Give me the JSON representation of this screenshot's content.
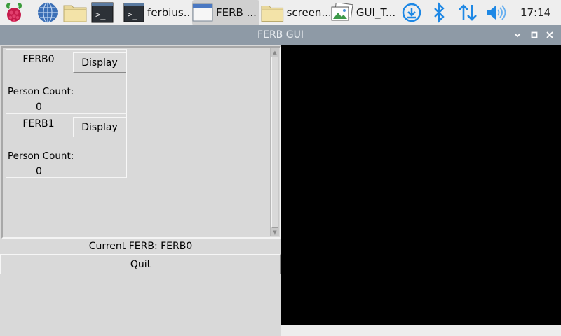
{
  "taskbar": {
    "menu_icon": "raspberry-pi-icon",
    "launchers": [
      {
        "name": "web-browser",
        "icon": "globe-icon"
      },
      {
        "name": "file-manager",
        "icon": "folder-icon"
      },
      {
        "name": "terminal",
        "icon": "terminal-icon"
      }
    ],
    "windows": [
      {
        "label": "ferbius...",
        "icon": "terminal-icon",
        "active": false
      },
      {
        "label": "FERB ...",
        "icon": "window-icon",
        "active": true
      },
      {
        "label": "screen...",
        "icon": "folder-icon",
        "active": false
      },
      {
        "label": "GUI_T...",
        "icon": "image-viewer-icon",
        "active": false
      }
    ],
    "tray": [
      "download-icon",
      "bluetooth-icon",
      "network-icon",
      "volume-icon"
    ],
    "clock": "17:14"
  },
  "window": {
    "title": "FERB GUI",
    "controls": [
      "minimize-icon",
      "maximize-icon",
      "close-icon"
    ]
  },
  "cameras": [
    {
      "name": "FERB0",
      "button": "Display",
      "count_label": "Person Count:",
      "count": "0"
    },
    {
      "name": "FERB1",
      "button": "Display",
      "count_label": "Person Count:",
      "count": "0"
    }
  ],
  "status": {
    "current": "Current FERB: FERB0"
  },
  "quit_label": "Quit",
  "colors": {
    "titlebar": "#8e9aa6",
    "panel": "#d9d9d9",
    "video": "#000000",
    "accent": "#1e88e5"
  }
}
